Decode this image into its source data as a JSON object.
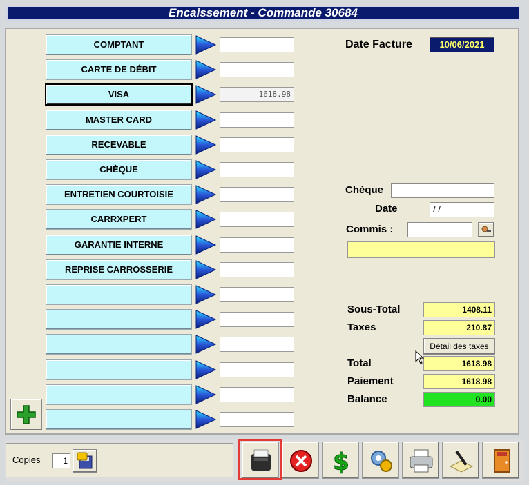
{
  "window": {
    "title": "Encaissement - Commande 30684"
  },
  "payment_methods": [
    {
      "label": "COMPTANT",
      "amount": ""
    },
    {
      "label": "CARTE DE DÉBIT",
      "amount": ""
    },
    {
      "label": "VISA",
      "amount": "1618.98",
      "selected": true
    },
    {
      "label": "MASTER CARD",
      "amount": ""
    },
    {
      "label": "RECEVABLE",
      "amount": ""
    },
    {
      "label": "CHÈQUE",
      "amount": ""
    },
    {
      "label": "ENTRETIEN COURTOISIE",
      "amount": ""
    },
    {
      "label": "CARRXPERT",
      "amount": ""
    },
    {
      "label": "GARANTIE INTERNE",
      "amount": ""
    },
    {
      "label": "REPRISE CARROSSERIE",
      "amount": ""
    },
    {
      "label": "",
      "amount": ""
    },
    {
      "label": "",
      "amount": ""
    },
    {
      "label": "",
      "amount": ""
    },
    {
      "label": "",
      "amount": ""
    },
    {
      "label": "",
      "amount": ""
    },
    {
      "label": "",
      "amount": ""
    }
  ],
  "invoice": {
    "date_label": "Date Facture",
    "date_value": "10/06/2021"
  },
  "cheque": {
    "cheque_label": "Chèque",
    "cheque_value": "",
    "date_label": "Date",
    "date_value": " / /",
    "commis_label": "Commis :",
    "commis_value": "",
    "note_value": ""
  },
  "totals": {
    "subtotal_label": "Sous-Total",
    "subtotal": "1408.11",
    "taxes_label": "Taxes",
    "taxes": "210.87",
    "tax_detail_button": "Détail des taxes",
    "total_label": "Total",
    "total": "1618.98",
    "payment_label": "Paiement",
    "payment": "1618.98",
    "balance_label": "Balance",
    "balance": "0.00"
  },
  "toolbar": {
    "copies_label": "Copies",
    "copies_value": "1"
  },
  "colors": {
    "title_bg": "#0a1b6e",
    "method_button": "#c4f7fb",
    "balance_ok": "#22e322",
    "totals_bg": "#ffff99",
    "highlight": "#e53935"
  },
  "icons": [
    "green-plus-icon",
    "floppy-disk-icon",
    "receipt-printer-icon",
    "cancel-icon",
    "dollar-icon",
    "settings-icon",
    "printer-icon",
    "signature-icon",
    "exit-door-icon"
  ]
}
